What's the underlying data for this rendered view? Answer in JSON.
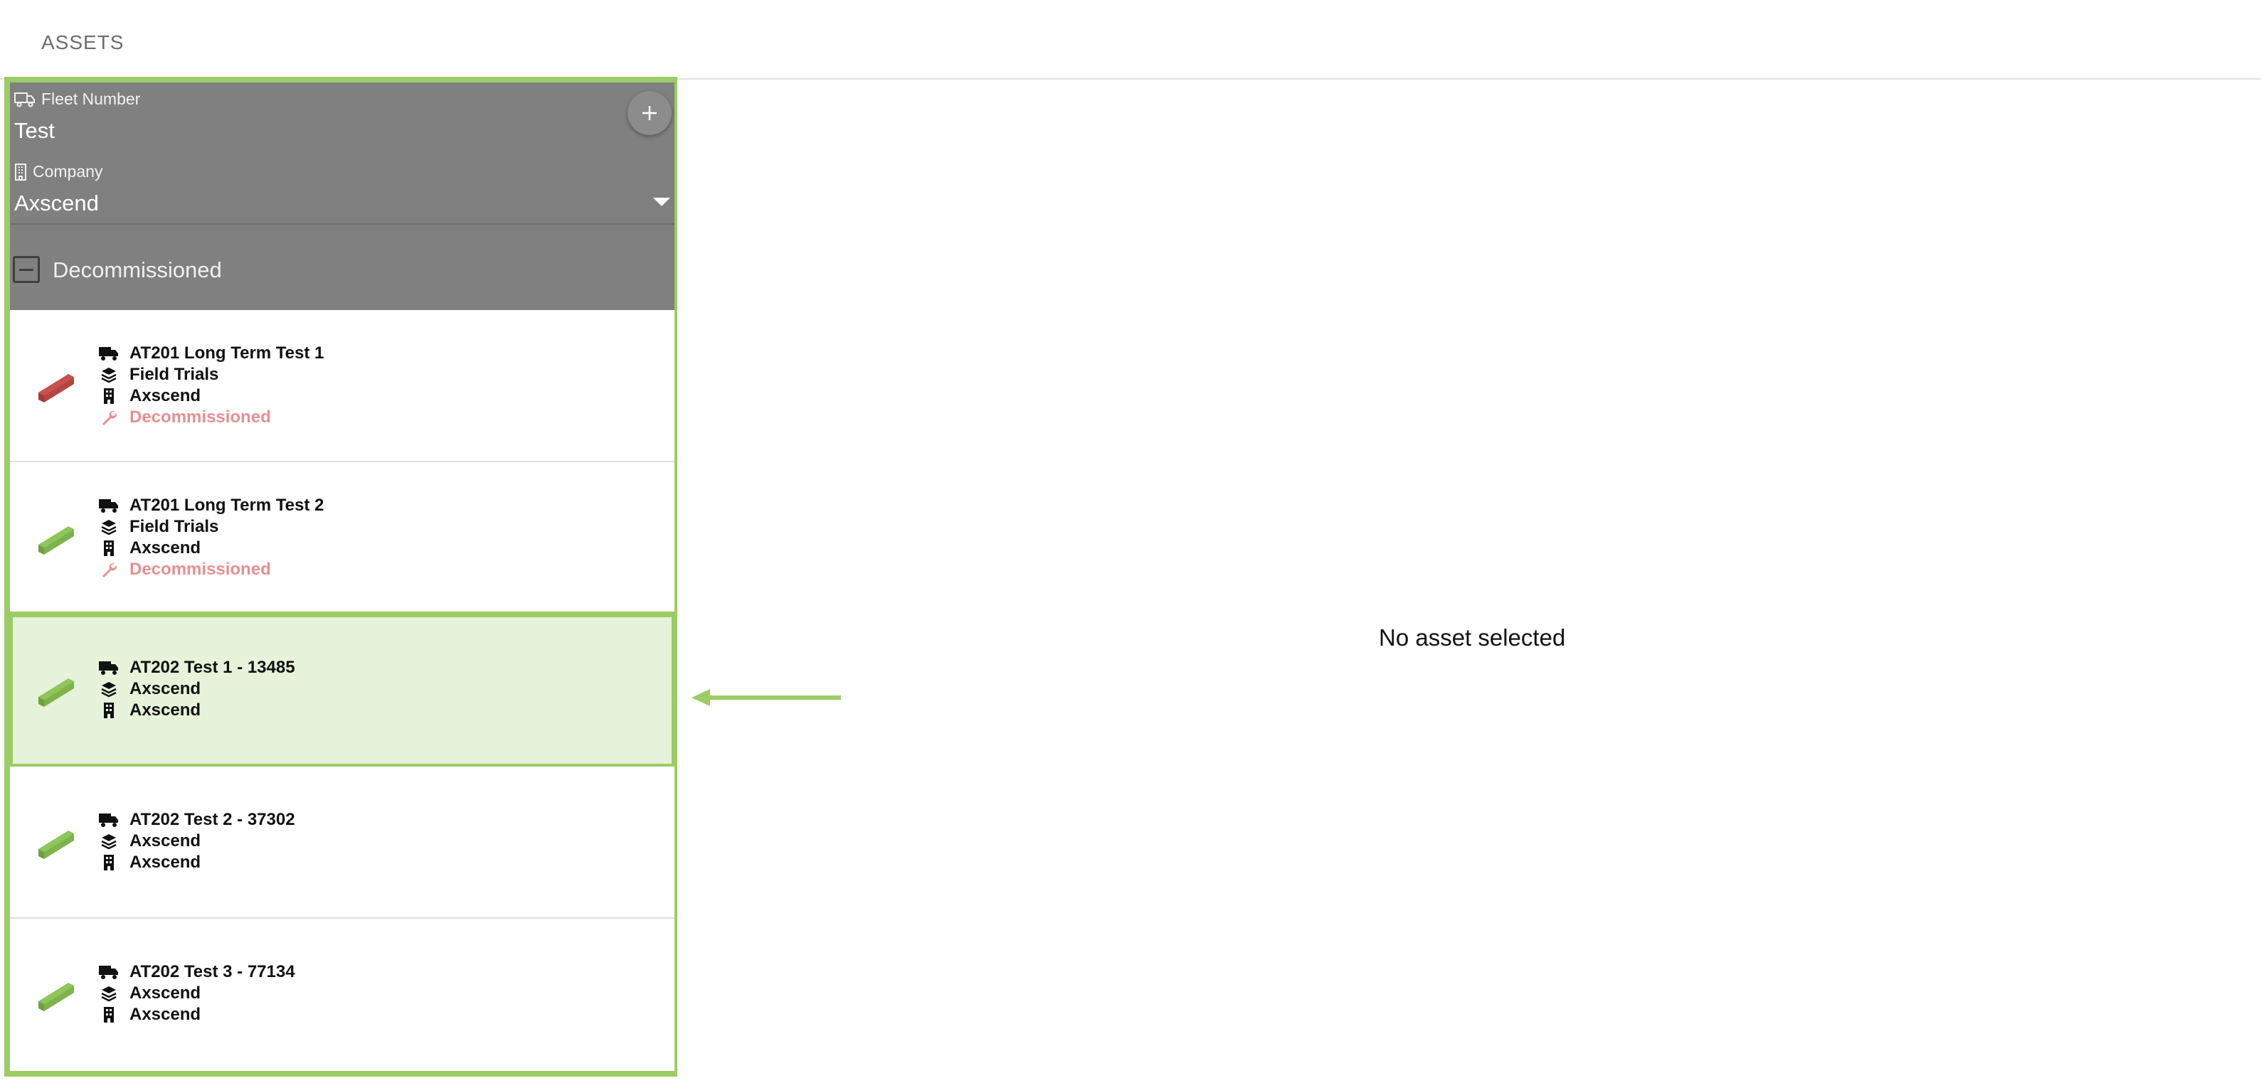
{
  "header": {
    "title": "ASSETS"
  },
  "filters": {
    "fleet_number_label": "Fleet Number",
    "fleet_number_value": "Test",
    "company_label": "Company",
    "company_value": "Axscend",
    "decommissioned_label": "Decommissioned"
  },
  "assets": [
    {
      "name": "AT201 Long Term Test 1",
      "group": "Field Trials",
      "company": "Axscend",
      "status": "Decommissioned",
      "bus_color": "#c9504e"
    },
    {
      "name": "AT201 Long Term Test 2",
      "group": "Field Trials",
      "company": "Axscend",
      "status": "Decommissioned",
      "bus_color": "#8fc55a"
    },
    {
      "name": "AT202 Test 1 - 13485",
      "group": "Axscend",
      "company": "Axscend",
      "bus_color": "#8fc55a"
    },
    {
      "name": "AT202 Test 2 - 37302",
      "group": "Axscend",
      "company": "Axscend",
      "bus_color": "#8fc55a"
    },
    {
      "name": "AT202 Test 3 - 77134",
      "group": "Axscend",
      "company": "Axscend",
      "bus_color": "#8fc55a"
    }
  ],
  "main": {
    "empty_message": "No asset selected"
  },
  "colors": {
    "accent": "#9ccc65",
    "filter_bg": "#808080",
    "selected_bg": "#e6f2d9",
    "decommissioned": "#e59090"
  }
}
